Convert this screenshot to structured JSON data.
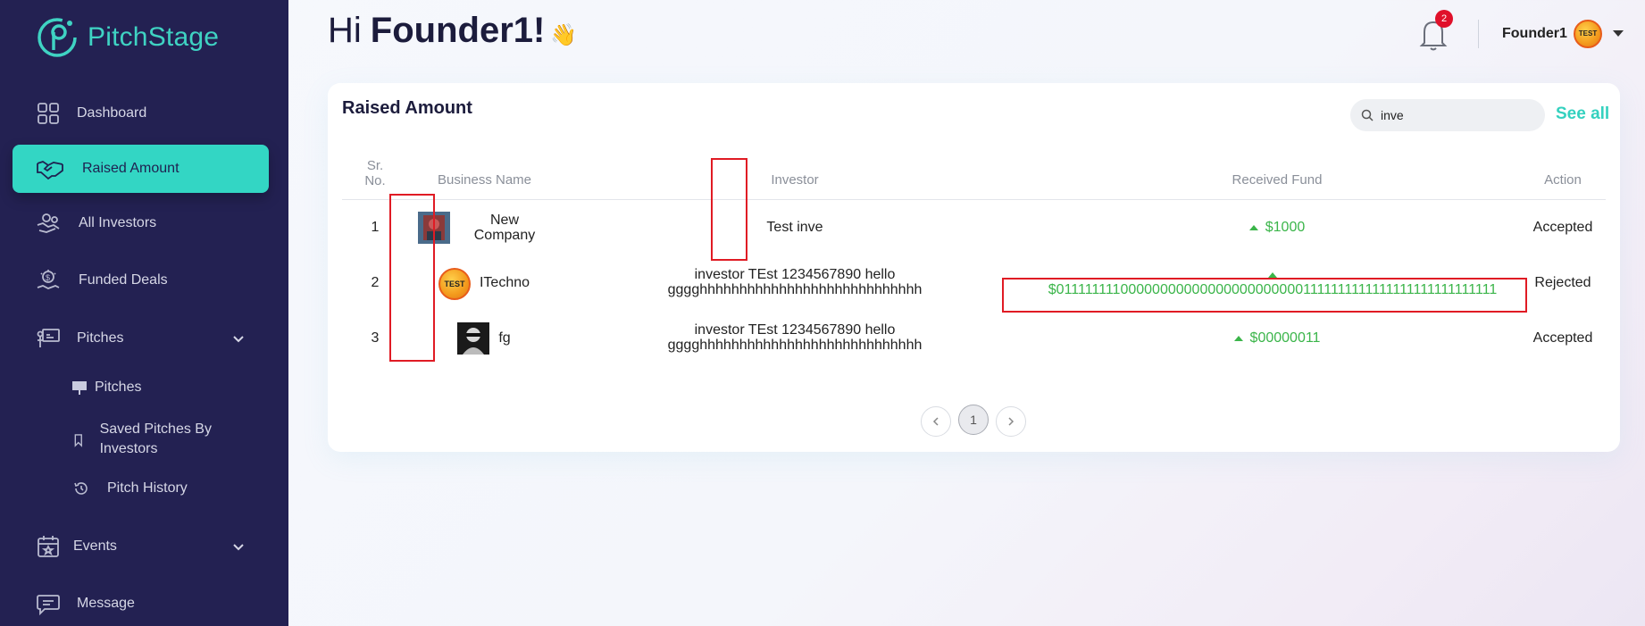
{
  "brand": {
    "name": "PitchStage"
  },
  "sidebar": {
    "items": [
      {
        "label": "Dashboard",
        "icon": "dashboard-icon"
      },
      {
        "label": "Raised Amount",
        "icon": "handshake-icon",
        "active": true
      },
      {
        "label": "All Investors",
        "icon": "investors-icon"
      },
      {
        "label": "Funded Deals",
        "icon": "funded-deals-icon"
      },
      {
        "label": "Pitches",
        "icon": "presentation-icon"
      },
      {
        "label": "Events",
        "icon": "calendar-icon"
      },
      {
        "label": "Message",
        "icon": "message-icon"
      }
    ],
    "sub_items": [
      {
        "label": "Pitches",
        "icon": "presentation-board-icon"
      },
      {
        "label": "Saved Pitches By Investors",
        "icon": "bookmark-icon"
      },
      {
        "label": "Pitch History",
        "icon": "history-icon"
      }
    ]
  },
  "header": {
    "greeting_prefix": "Hi",
    "greeting_name": "Founder1!",
    "greeting_emoji": "👋",
    "notification_count": "2",
    "user_name": "Founder1",
    "avatar_text": "TEST"
  },
  "card": {
    "title": "Raised Amount",
    "search_value": "inve",
    "see_all": "See all",
    "columns": {
      "sr_line1": "Sr.",
      "sr_line2": "No.",
      "business": "Business Name",
      "investor": "Investor",
      "fund": "Received Fund",
      "action": "Action"
    },
    "rows": [
      {
        "sr": "1",
        "business_line1": "New",
        "business_line2": "Company",
        "investor_line1": "Test inve",
        "investor_line2": "",
        "fund": "$1000",
        "action": "Accepted"
      },
      {
        "sr": "2",
        "business_line1": "ITechno",
        "business_line2": "",
        "investor_line1": "investor TEst 1234567890 hello",
        "investor_line2": "gggghhhhhhhhhhhhhhhhhhhhhhhhhhhh",
        "fund": "$011111111000000000000000000000001111111111111111111111111111",
        "action": "Rejected"
      },
      {
        "sr": "3",
        "business_line1": "fg",
        "business_line2": "",
        "investor_line1": "investor TEst 1234567890 hello",
        "investor_line2": "gggghhhhhhhhhhhhhhhhhhhhhhhhhhhh",
        "fund": "$00000011",
        "action": "Accepted"
      }
    ],
    "pagination": {
      "current": "1"
    }
  },
  "colors": {
    "sidebar_bg": "#232152",
    "accent": "#33d6c4",
    "fund_green": "#3bb54a",
    "highlight_red": "#e01b24"
  }
}
